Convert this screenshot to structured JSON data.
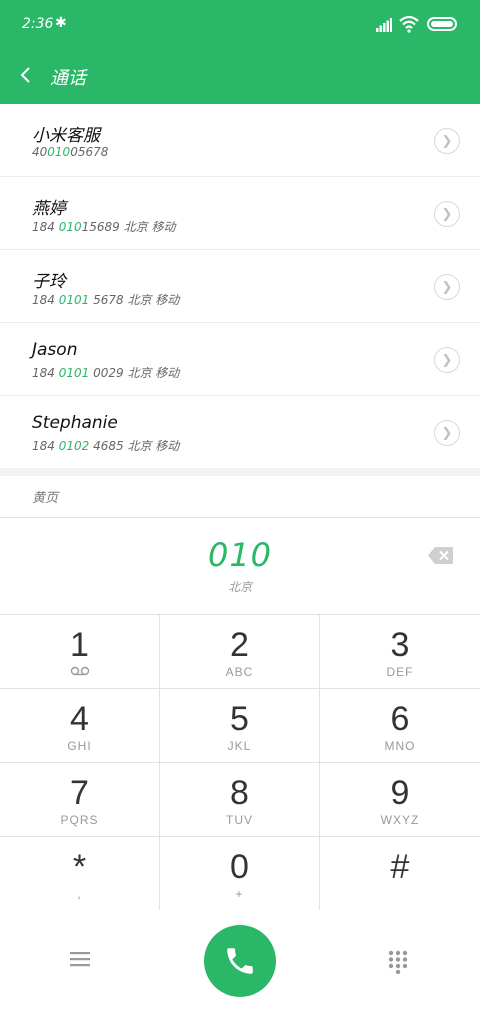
{
  "status": {
    "time": "2:36",
    "bluetooth_icon": "bluetooth-icon",
    "signal_icon": "signal-icon",
    "wifi_icon": "wifi-icon",
    "battery_icon": "battery-icon"
  },
  "header": {
    "title": "通话",
    "back_icon": "back-arrow-icon"
  },
  "colors": {
    "accent": "#2ab868",
    "text": "#222222",
    "muted": "#999999"
  },
  "contacts": [
    {
      "name": "小米客服",
      "num_pre": "40",
      "num_hl": "010",
      "num_post": "05678",
      "location": ""
    },
    {
      "name": "燕婷",
      "num_pre": "184 ",
      "num_hl": "010",
      "num_post": "15689",
      "location": " 北京 移动"
    },
    {
      "name": "子玲",
      "num_pre": "184 ",
      "num_hl": "0101",
      "num_post": " 5678",
      "location": " 北京 移动"
    },
    {
      "name": "Jason",
      "num_pre": "184 ",
      "num_hl": "0101",
      "num_post": " 0029",
      "location": " 北京 移动"
    },
    {
      "name": "Stephanie",
      "num_pre": "184 ",
      "num_hl": "0102",
      "num_post": " 4685",
      "location": " 北京 移动"
    }
  ],
  "yellow_pages": "黄页",
  "dialer": {
    "number": "010",
    "location": "北京"
  },
  "keys": [
    {
      "digit": "1",
      "letters": ""
    },
    {
      "digit": "2",
      "letters": "ABC"
    },
    {
      "digit": "3",
      "letters": "DEF"
    },
    {
      "digit": "4",
      "letters": "GHI"
    },
    {
      "digit": "5",
      "letters": "JKL"
    },
    {
      "digit": "6",
      "letters": "MNO"
    },
    {
      "digit": "7",
      "letters": "PQRS"
    },
    {
      "digit": "8",
      "letters": "TUV"
    },
    {
      "digit": "9",
      "letters": "WXYZ"
    },
    {
      "digit": "*",
      "letters": ","
    },
    {
      "digit": "0",
      "letters": "+"
    },
    {
      "digit": "#",
      "letters": ""
    }
  ],
  "bottom": {
    "menu_icon": "menu-icon",
    "call_icon": "phone-icon",
    "dialpad_icon": "dialpad-icon"
  }
}
